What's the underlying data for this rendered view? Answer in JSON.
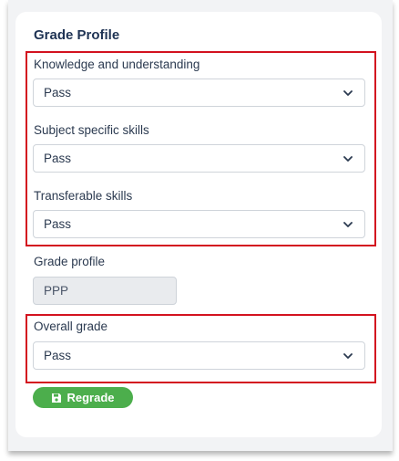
{
  "panel": {
    "title": "Grade Profile"
  },
  "fields": {
    "knowledge": {
      "label": "Knowledge and understanding",
      "value": "Pass"
    },
    "subject": {
      "label": "Subject specific skills",
      "value": "Pass"
    },
    "transferable": {
      "label": "Transferable skills",
      "value": "Pass"
    },
    "grade_profile": {
      "label": "Grade profile",
      "value": "PPP"
    },
    "overall": {
      "label": "Overall grade",
      "value": "Pass"
    }
  },
  "actions": {
    "regrade_label": "Regrade"
  },
  "colors": {
    "highlight": "#d3121f",
    "button": "#4cae4c",
    "title": "#1f3354"
  },
  "icons": {
    "dropdown": "chevron-down-icon",
    "save": "floppy-disk-icon"
  }
}
